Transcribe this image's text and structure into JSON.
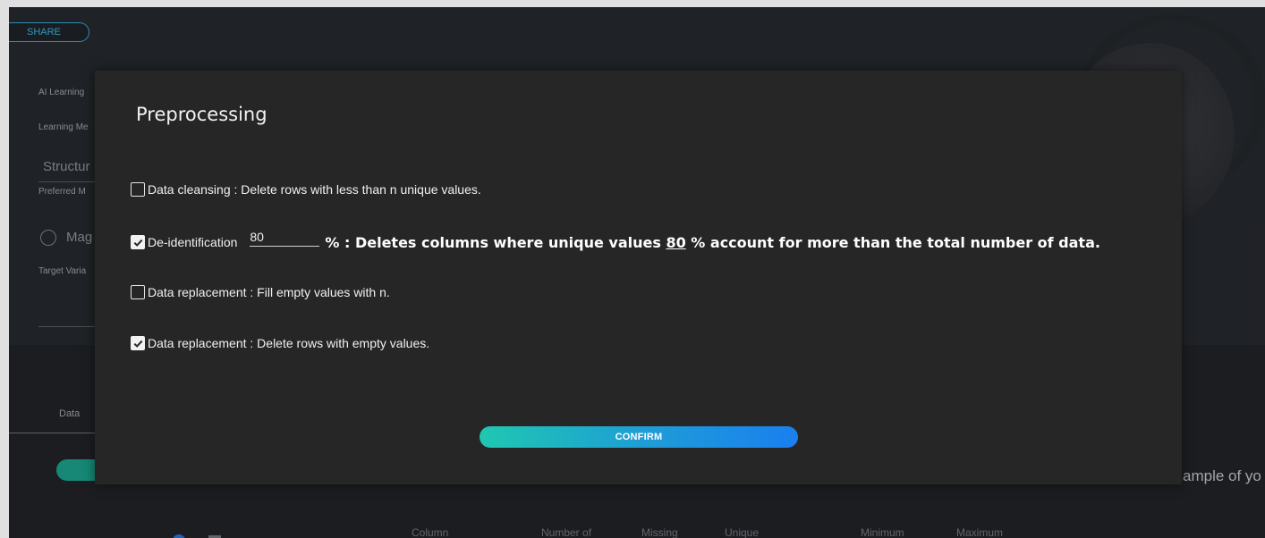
{
  "background": {
    "share_label": "SHARE",
    "ai_learning_label": "AI Learning",
    "learning_method_label": "Learning Me",
    "structure_text": "Structur",
    "preferred_label": "Preferred M",
    "mag_text": "Mag",
    "target_label": "Target Varia",
    "data_tab": "Data",
    "right_text": "ample of yo",
    "columns": [
      "Column",
      "Number of",
      "Missing",
      "Unique",
      "Minimum",
      "Maximum"
    ]
  },
  "modal": {
    "title": "Preprocessing",
    "options": [
      {
        "checked": false,
        "label": "Data cleansing : Delete rows with less than n unique values."
      },
      {
        "checked": true,
        "label": "De-identification",
        "input_value": "80",
        "desc_prefix": "% : Deletes columns where unique values ",
        "desc_value": "80",
        "desc_suffix": " % account for more than the total number of data."
      },
      {
        "checked": false,
        "label": "Data replacement : Fill empty values with n."
      },
      {
        "checked": true,
        "label": "Data replacement : Delete rows with empty values."
      }
    ],
    "confirm_label": "CONFIRM"
  },
  "colors": {
    "modal_bg": "#262626",
    "accent_start": "#1fc7b0",
    "accent_end": "#1a7fef",
    "share": "#3aaed6"
  }
}
